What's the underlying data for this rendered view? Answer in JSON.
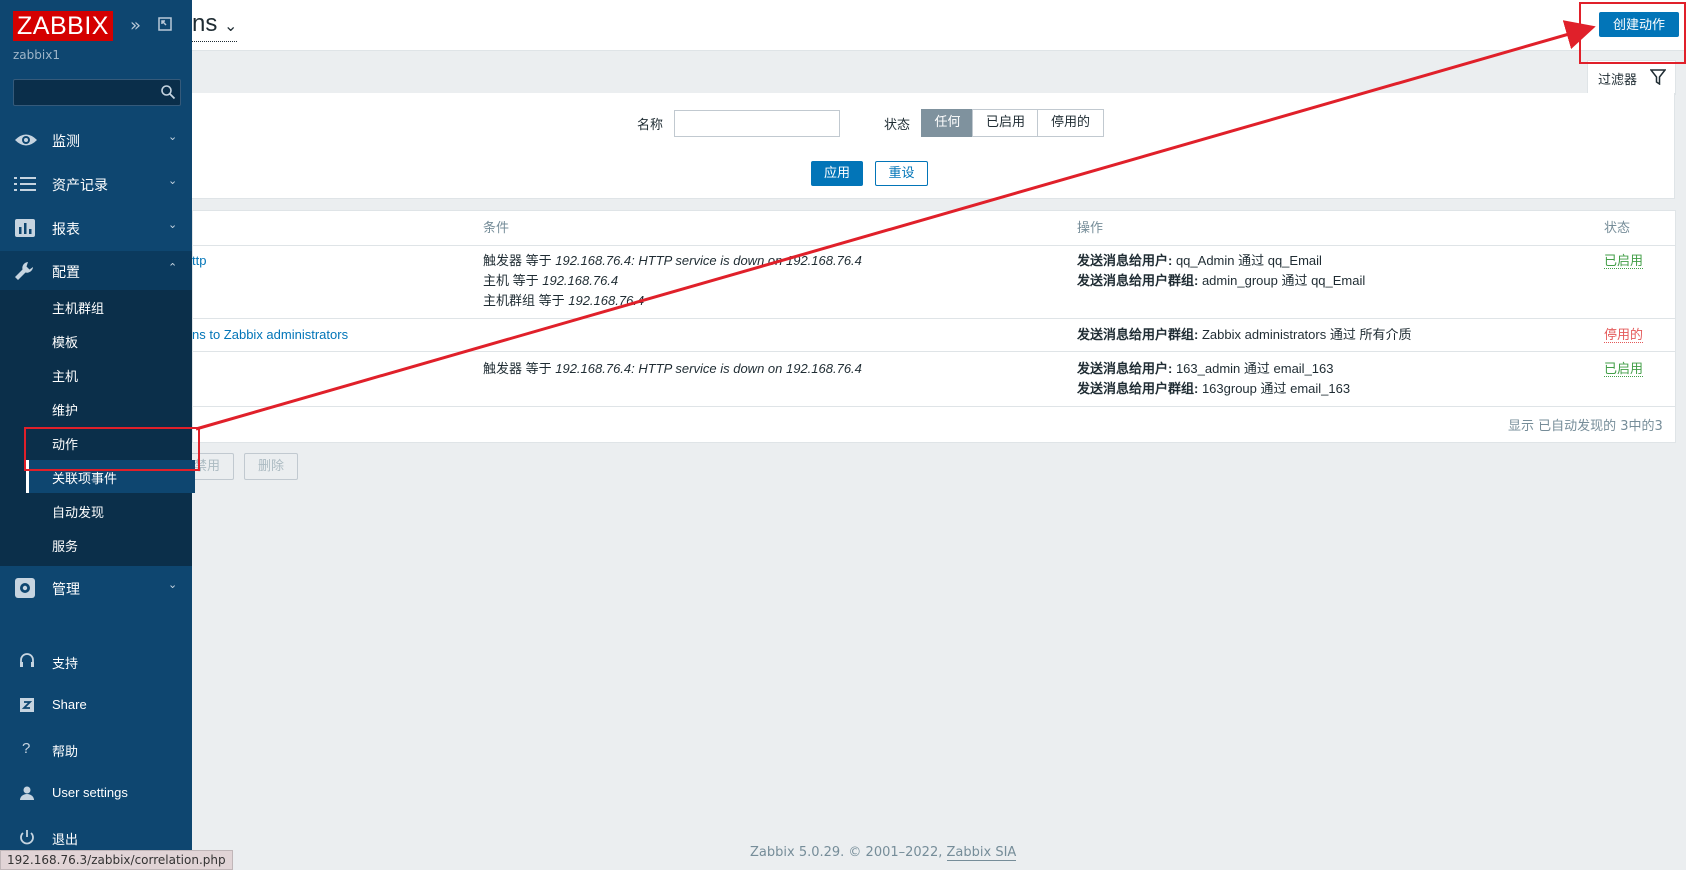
{
  "sidebar": {
    "logo": "ZABBIX",
    "server_name": "zabbix1",
    "search_placeholder": "",
    "menu": [
      {
        "label": "监测",
        "icon": "eye-icon"
      },
      {
        "label": "资产记录",
        "icon": "list-icon"
      },
      {
        "label": "报表",
        "icon": "bar-chart-icon"
      },
      {
        "label": "配置",
        "icon": "wrench-icon"
      },
      {
        "label": "管理",
        "icon": "gear-icon"
      }
    ],
    "submenu": [
      "主机群组",
      "模板",
      "主机",
      "维护",
      "动作",
      "关联项事件",
      "自动发现",
      "服务"
    ],
    "bottom": [
      {
        "label": "支持",
        "icon": "headset-icon"
      },
      {
        "label": "Share",
        "icon": "share-z-icon"
      },
      {
        "label": "帮助",
        "icon": "question-icon"
      },
      {
        "label": "User settings",
        "icon": "user-icon"
      },
      {
        "label": "退出",
        "icon": "power-icon"
      }
    ]
  },
  "header": {
    "title": "ns",
    "create_button": "创建动作"
  },
  "filter": {
    "tab_label": "过滤器",
    "name_label": "名称",
    "name_value": "",
    "status_label": "状态",
    "status_options": [
      "任何",
      "已启用",
      "停用的"
    ],
    "status_selected": "任何",
    "apply": "应用",
    "reset": "重设"
  },
  "table": {
    "headers": {
      "conditions": "条件",
      "operations": "操作",
      "status": "状态"
    },
    "rows": [
      {
        "name": "ttp",
        "conditions": [
          {
            "prefix": "触发器 等于 ",
            "value": "192.168.76.4: HTTP service is down on 192.168.76.4"
          },
          {
            "prefix": "主机 等于 ",
            "value": "192.168.76.4"
          },
          {
            "prefix": "主机群组 等于 ",
            "value": "192.168.76.4"
          }
        ],
        "operations": [
          {
            "label": "发送消息给用户:",
            "text": " qq_Admin 通过 qq_Email"
          },
          {
            "label": "发送消息给用户群组:",
            "text": " admin_group 通过 qq_Email"
          }
        ],
        "status": "已启用"
      },
      {
        "name": "ns to Zabbix administrators",
        "conditions": [],
        "operations": [
          {
            "label": "发送消息给用户群组:",
            "text": " Zabbix administrators 通过 所有介质"
          }
        ],
        "status": "停用的"
      },
      {
        "name": "",
        "conditions": [
          {
            "prefix": "触发器 等于 ",
            "value": "192.168.76.4: HTTP service is down on 192.168.76.4"
          }
        ],
        "operations": [
          {
            "label": "发送消息给用户:",
            "text": " 163_admin 通过 email_163"
          },
          {
            "label": "发送消息给用户群组:",
            "text": " 163group 通过 email_163"
          }
        ],
        "status": "已启用"
      }
    ],
    "count_text": "显示 已自动发现的 3中的3"
  },
  "mass_actions": {
    "disable": "禁用",
    "delete": "删除"
  },
  "footer": {
    "text": "Zabbix 5.0.29. © 2001–2022, ",
    "link": "Zabbix SIA"
  },
  "status_url": "192.168.76.3/zabbix/correlation.php",
  "colors": {
    "sidebar": "#0e4670",
    "accent": "#0275b8",
    "enabled": "#429e47",
    "disabled": "#e45959",
    "annotation": "#e0202a"
  }
}
